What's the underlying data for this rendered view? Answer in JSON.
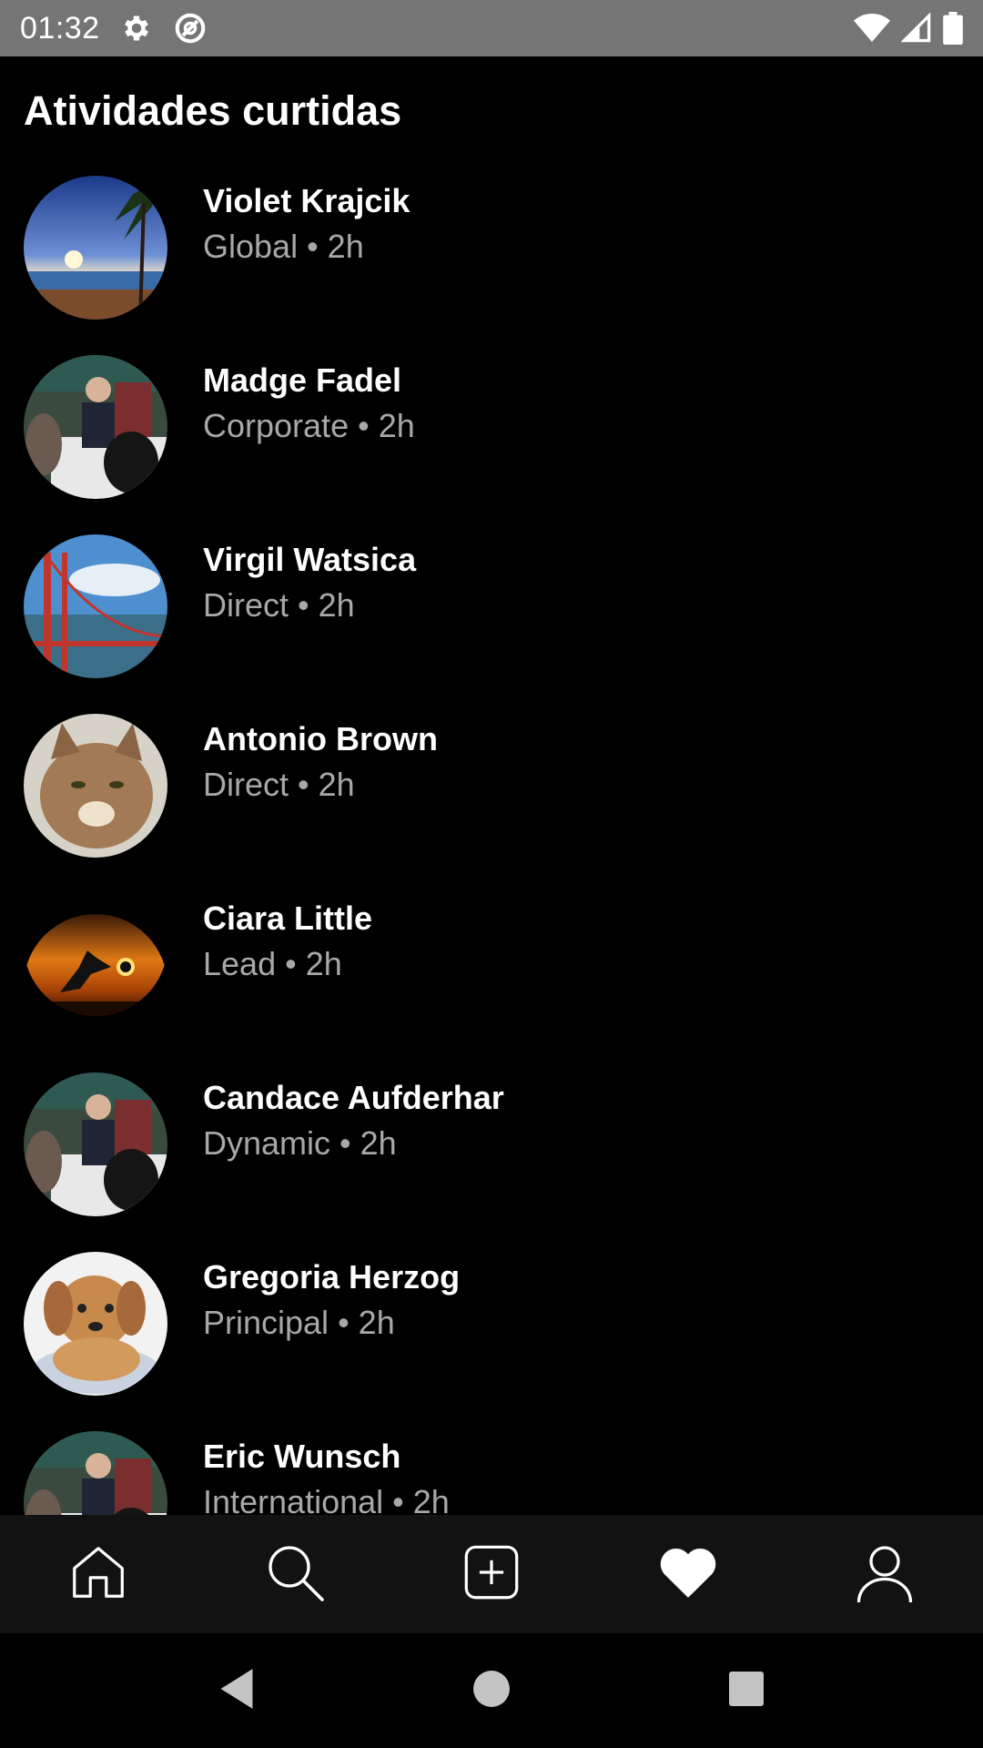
{
  "status_bar": {
    "time": "01:32",
    "icons_left": [
      "gear-icon",
      "data-saver-icon"
    ],
    "icons_right": [
      "wifi-icon",
      "signal-icon",
      "battery-icon"
    ],
    "background": "#757575"
  },
  "page": {
    "title": "Atividades curtidas"
  },
  "items": [
    {
      "name": "Violet Krajcik",
      "label": "Global",
      "time": "2h",
      "separator": "•",
      "avatar": "sunset-palm-photo"
    },
    {
      "name": "Madge Fadel",
      "label": "Corporate",
      "time": "2h",
      "separator": "•",
      "avatar": "office-meeting-photo"
    },
    {
      "name": "Virgil Watsica",
      "label": "Direct",
      "time": "2h",
      "separator": "•",
      "avatar": "golden-gate-bridge-photo"
    },
    {
      "name": "Antonio Brown",
      "label": "Direct",
      "time": "2h",
      "separator": "•",
      "avatar": "tabby-cat-photo"
    },
    {
      "name": "Ciara Little",
      "label": "Lead",
      "time": "2h",
      "separator": "•",
      "avatar": "sunset-soccer-photo"
    },
    {
      "name": "Candace Aufderhar",
      "label": "Dynamic",
      "time": "2h",
      "separator": "•",
      "avatar": "office-meeting-photo"
    },
    {
      "name": "Gregoria Herzog",
      "label": "Principal",
      "time": "2h",
      "separator": "•",
      "avatar": "puppy-photo"
    },
    {
      "name": "Eric Wunsch",
      "label": "International",
      "time": "2h",
      "separator": "•",
      "avatar": "office-meeting-photo"
    }
  ],
  "tab_bar": {
    "tabs": [
      "home-icon",
      "search-icon",
      "add-post-icon",
      "heart-icon",
      "profile-icon"
    ],
    "active": "heart-icon"
  },
  "nav_bar": {
    "buttons": [
      "back-icon",
      "home-circle-icon",
      "recents-icon"
    ]
  },
  "colors": {
    "background": "#000000",
    "secondary_text": "#a8a8a8",
    "tab_bar": "#121212"
  }
}
